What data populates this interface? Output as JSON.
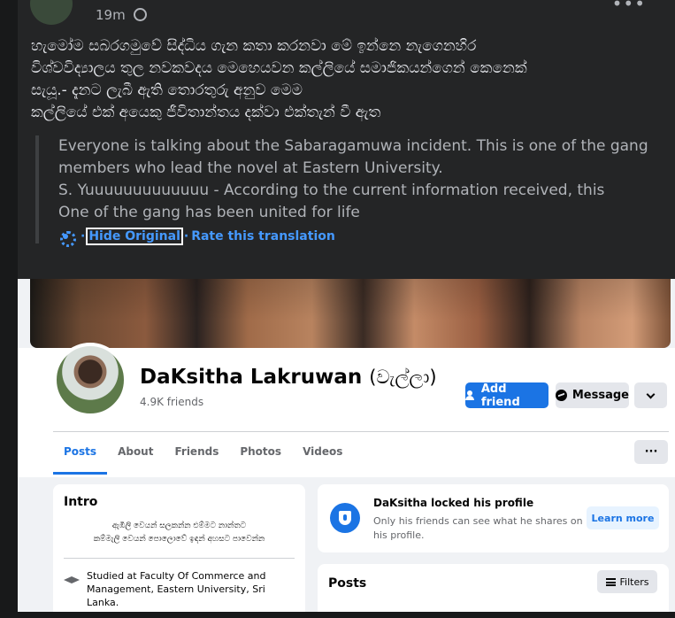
{
  "post": {
    "time": "19m",
    "sinhala_lines": [
      "හැමෝම සබරගමුවේ සිද්ධිය ගැන කතා කරනවා මේ ඉන්නෙ නැගෙනහිර",
      "විශ්වවිද්‍යාලය තුල නවකවදය මෙහෙයවන කල්ලියේ සමාජිකයන්ගෙන් කෙනෙක්",
      "සැයූ.- දැනට ලැබී ඇති තොරතුරු අනුව මෙම",
      "කල්ලියේ එක් අයෙකු ජීවිතාන්තය දක්වා එක්තැන් වී ඇත"
    ],
    "translation_lines": [
      "Everyone is talking about the Sabaragamuwa incident. This is one of the gang",
      "members who lead the novel at Eastern University.",
      "S. Yuuuuuuuuuuuuu - According to the current information received, this",
      "One of the gang has been united for life"
    ],
    "hide_original_label": "Hide Original",
    "rate_translation_label": "Rate this translation"
  },
  "profile": {
    "name": "DaKsitha Lakruwan",
    "nickname": "(වැල්ලා)",
    "friends": "4.9K friends",
    "add_friend_label": "Add friend",
    "message_label": "Message",
    "more_label": "···",
    "tabs": [
      "Posts",
      "About",
      "Friends",
      "Photos",
      "Videos"
    ],
    "intro": {
      "title": "Intro",
      "bio_line1": "ඇඹිලි වෙයන් සලකන්න එම්මට නාන්තට",
      "bio_line2": "කම්මැලි වෙයන් පොලොවේ ඉඳන් අහසට පාවෙන්න",
      "study_prefix": "Studied at ",
      "study_place": "Faculty Of Commerce and Management, Eastern University, Sri Lanka."
    },
    "locked": {
      "title": "DaKsitha locked his profile",
      "description": "Only his friends can see what he shares on his profile.",
      "learn_more_label": "Learn more"
    },
    "posts": {
      "title": "Posts",
      "filters_label": "Filters"
    }
  },
  "colors": {
    "background": "#18191a",
    "card": "#242526",
    "link": "#4599ff",
    "fb_blue": "#1b74e4"
  }
}
